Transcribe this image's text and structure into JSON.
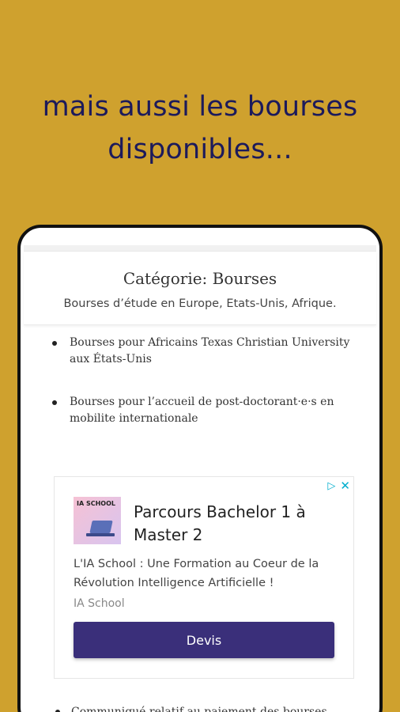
{
  "headline": {
    "line1": "mais aussi les bourses",
    "line2": "disponibles..."
  },
  "category": {
    "title": "Catégorie: Bourses",
    "description": "Bourses d’étude en Europe, Etats-Unis, Afrique."
  },
  "posts": [
    {
      "title": "Bourses pour Africains Texas Christian University aux États-Unis"
    },
    {
      "title": "Bourses pour l’accueil de post-doctorant·e·s en mobilite internationale"
    }
  ],
  "ad": {
    "logo_text": "IA SCHOOL",
    "title": "Parcours Bachelor 1 à Master 2",
    "description": "L'IA School : Une Formation au Coeur de la Révolution Intelligence Artificielle !",
    "source": "IA School",
    "button_label": "Devis",
    "accent_color": "#3a2f7a",
    "adchoices_icon": "play-triangle-icon",
    "close_icon": "close-icon"
  },
  "partial_post": {
    "title": "Communiqué relatif au paiement des bourses"
  },
  "colors": {
    "background": "#CFA12E",
    "headline": "#1c1a5b"
  }
}
